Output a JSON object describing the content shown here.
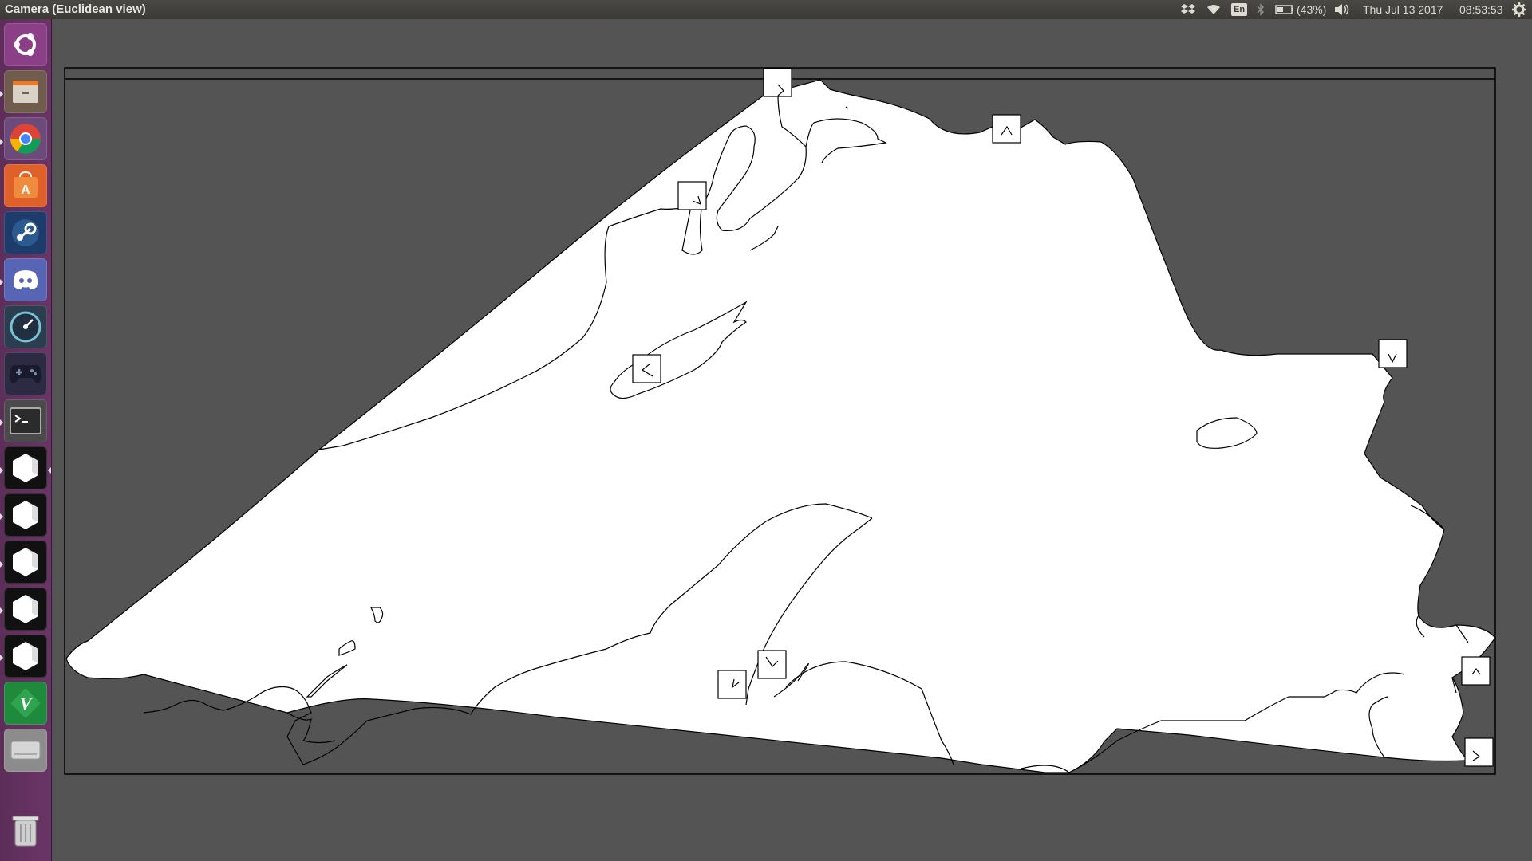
{
  "window": {
    "title": "Camera (Euclidean view)"
  },
  "tray": {
    "language": "En",
    "battery": "(43%)",
    "date": "Thu Jul 13 2017",
    "time": "08:53:53"
  },
  "launcher": {
    "items": [
      {
        "name": "ubuntu-dash-icon"
      },
      {
        "name": "files-icon"
      },
      {
        "name": "chrome-icon"
      },
      {
        "name": "software-center-icon"
      },
      {
        "name": "steam-icon"
      },
      {
        "name": "discord-icon"
      },
      {
        "name": "stacer-icon"
      },
      {
        "name": "gamepad-icon"
      },
      {
        "name": "terminal-icon"
      },
      {
        "name": "polyhedron-app-icon"
      },
      {
        "name": "polyhedron-app-icon"
      },
      {
        "name": "polyhedron-app-icon"
      },
      {
        "name": "polyhedron-app-icon"
      },
      {
        "name": "polyhedron-app-icon"
      },
      {
        "name": "vim-icon"
      },
      {
        "name": "disk-drive-icon"
      },
      {
        "name": "trash-icon"
      }
    ]
  },
  "colors": {
    "background": "#545454",
    "launcher": "#633160",
    "topbar": "#3e3d39",
    "landmass": "#ffffff",
    "outline": "#000000"
  }
}
